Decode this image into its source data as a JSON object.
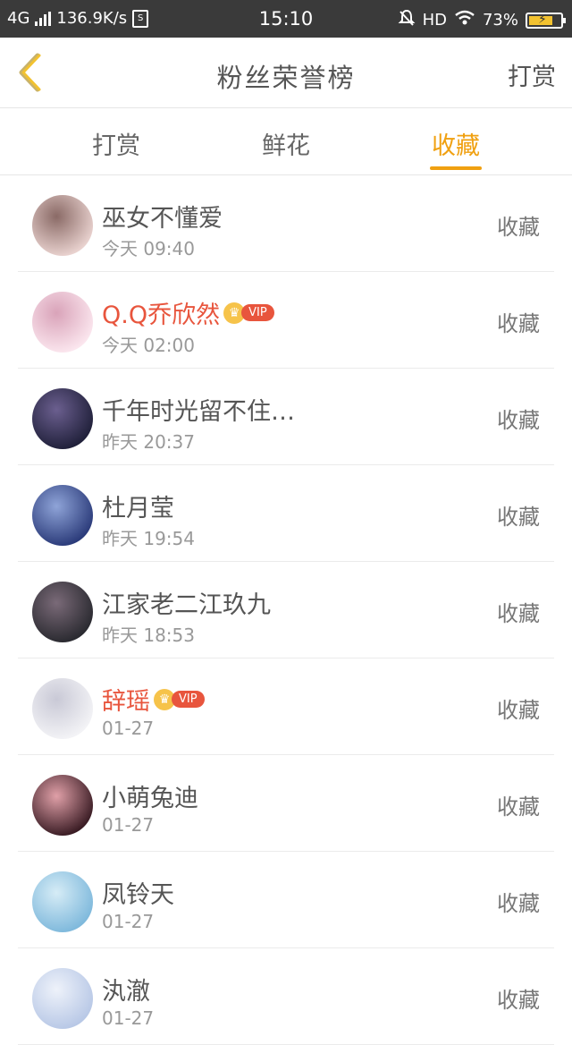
{
  "status_bar": {
    "network": "4G",
    "speed": "136.9K/s",
    "time": "15:10",
    "hd": "HD",
    "battery": "73%"
  },
  "nav": {
    "title": "粉丝荣誉榜",
    "right_action": "打赏"
  },
  "tabs": [
    {
      "label": "打赏",
      "active": false
    },
    {
      "label": "鲜花",
      "active": false
    },
    {
      "label": "收藏",
      "active": true
    }
  ],
  "colors": {
    "accent": "#f0a010",
    "vip_name": "#e8553d"
  },
  "vip_label": "VIP",
  "fans": [
    {
      "name": "巫女不懂爱",
      "time": "今天 09:40",
      "action": "收藏",
      "vip": false,
      "avatar": [
        "#e9d2cf",
        "#8a6a66"
      ]
    },
    {
      "name": "Q.Q乔欣然",
      "time": "今天 02:00",
      "action": "收藏",
      "vip": true,
      "avatar": [
        "#fbe6ee",
        "#d9a3b9"
      ]
    },
    {
      "name": "千年时光留不住…",
      "time": "昨天 20:37",
      "action": "收藏",
      "vip": false,
      "avatar": [
        "#20203a",
        "#6b5f8f"
      ]
    },
    {
      "name": "杜月莹",
      "time": "昨天 19:54",
      "action": "收藏",
      "vip": false,
      "avatar": [
        "#2b3b7a",
        "#8fa4d8"
      ]
    },
    {
      "name": "江家老二江玖九",
      "time": "昨天 18:53",
      "action": "收藏",
      "vip": false,
      "avatar": [
        "#2a2a30",
        "#7a6a78"
      ]
    },
    {
      "name": "辞瑶",
      "time": "01-27",
      "action": "收藏",
      "vip": true,
      "avatar": [
        "#f3f3f6",
        "#c9c9d6"
      ]
    },
    {
      "name": "小萌兔迪",
      "time": "01-27",
      "action": "收藏",
      "vip": false,
      "avatar": [
        "#3a1c24",
        "#e0a0a8"
      ]
    },
    {
      "name": "凤铃天",
      "time": "01-27",
      "action": "收藏",
      "vip": false,
      "avatar": [
        "#7fb9dc",
        "#d6ecf6"
      ]
    },
    {
      "name": "汍澈",
      "time": "01-27",
      "action": "收藏",
      "vip": false,
      "avatar": [
        "#b8c8e6",
        "#eef2fa"
      ]
    }
  ]
}
